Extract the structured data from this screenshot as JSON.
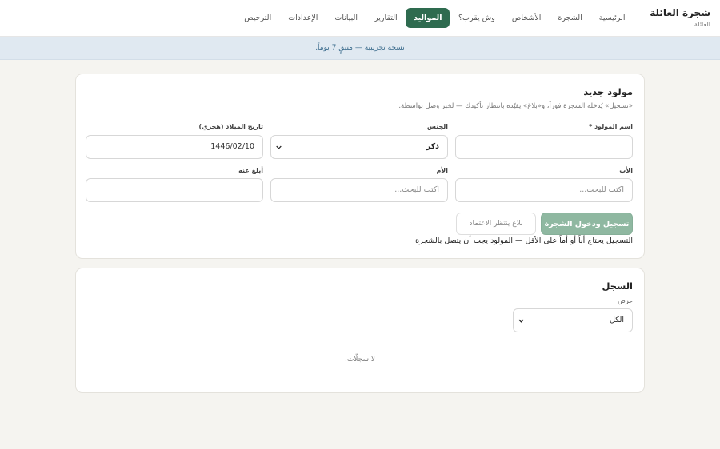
{
  "brand": {
    "title": "شجرة العائلة",
    "subtitle": "العائلة"
  },
  "nav": [
    {
      "label": "الرئيسية"
    },
    {
      "label": "الشجرة"
    },
    {
      "label": "الأشخاص"
    },
    {
      "label": "وش يقرب؟"
    },
    {
      "label": "المواليد",
      "active": true
    },
    {
      "label": "التقارير"
    },
    {
      "label": "البيانات"
    },
    {
      "label": "الإعدادات"
    },
    {
      "label": "الترخيص"
    }
  ],
  "banner": {
    "text": "نسخة تجريبية — متبقٍ 7 يوماً."
  },
  "newBirth": {
    "title": "مولود جديد",
    "subtitle": "«تسجيل» يُدخله الشجرة فوراً، و«بلاغ» يقيّده بانتظار تأكيدك — لخبر وصل بواسطة.",
    "name_label": "اسم المولود *",
    "name_value": "",
    "gender_label": "الجنس",
    "gender_value": "ذكر",
    "dob_label": "تاريخ الميلاد (هجري)",
    "dob_value": "1446/02/10",
    "father_label": "الأب",
    "father_placeholder": "اكتب للبحث...",
    "mother_label": "الأم",
    "mother_placeholder": "اكتب للبحث...",
    "reporter_label": "أبلغ عنه",
    "reporter_value": "",
    "register_button": "تسجيل ودخول الشجرة",
    "report_button": "بلاغ ينتظر الاعتماد",
    "hint": "التسجيل يحتاج أباً أو أماً على الأقل — المولود يجب أن يتصل بالشجرة."
  },
  "records": {
    "title": "السجل",
    "view_label": "عرض",
    "view_value": "الكل",
    "empty": "لا سجلّات."
  },
  "colors": {
    "accent": "#2e6b4f",
    "primary_disabled": "#8fb8a1",
    "banner_bg": "#e0e9f1",
    "banner_text": "#3a6b8c",
    "page_bg": "#f5f4f0"
  }
}
